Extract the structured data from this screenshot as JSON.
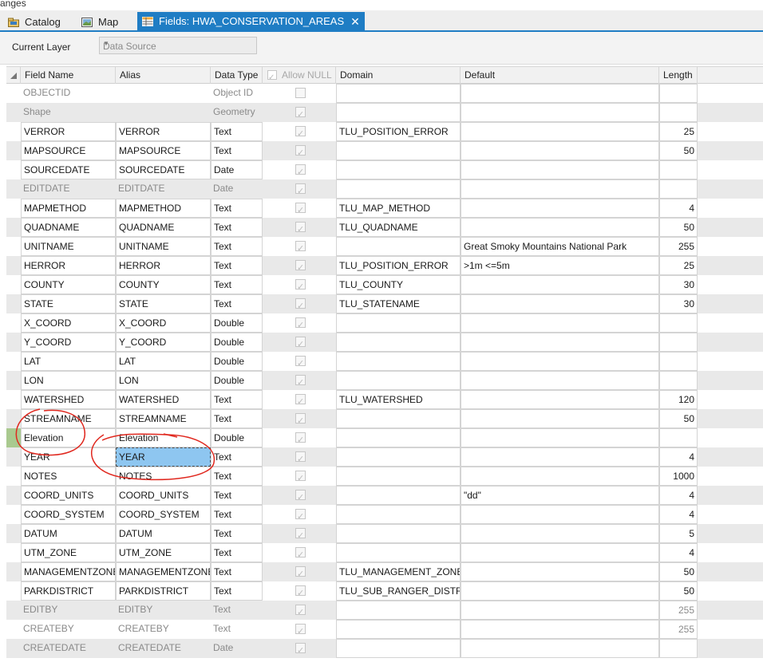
{
  "top_label": "anges",
  "tabs": [
    {
      "label": "Catalog",
      "icon": "catalog-icon"
    },
    {
      "label": "Map",
      "icon": "map-icon"
    },
    {
      "label": "Fields:  HWA_CONSERVATION_AREAS",
      "icon": "fields-table-icon"
    }
  ],
  "layer": {
    "label": "Current Layer",
    "value": "Data Source"
  },
  "columns": [
    "Field Name",
    "Alias",
    "Data Type",
    "Allow NULL",
    "Domain",
    "Default",
    "Length"
  ],
  "rows": [
    {
      "name": "OBJECTID",
      "alias": "",
      "type": "Object ID",
      "null": false,
      "domain": "",
      "default": "",
      "length": "",
      "ro": true
    },
    {
      "name": "Shape",
      "alias": "",
      "type": "Geometry",
      "null": true,
      "domain": "",
      "default": "",
      "length": "",
      "ro": true
    },
    {
      "name": "VERROR",
      "alias": "VERROR",
      "type": "Text",
      "null": true,
      "domain": "TLU_POSITION_ERROR",
      "default": "",
      "length": "25",
      "ro": false
    },
    {
      "name": "MAPSOURCE",
      "alias": "MAPSOURCE",
      "type": "Text",
      "null": true,
      "domain": "",
      "default": "",
      "length": "50",
      "ro": false
    },
    {
      "name": "SOURCEDATE",
      "alias": "SOURCEDATE",
      "type": "Date",
      "null": true,
      "domain": "",
      "default": "",
      "length": "",
      "ro": false
    },
    {
      "name": "EDITDATE",
      "alias": "EDITDATE",
      "type": "Date",
      "null": true,
      "domain": "",
      "default": "",
      "length": "",
      "ro": true
    },
    {
      "name": "MAPMETHOD",
      "alias": "MAPMETHOD",
      "type": "Text",
      "null": true,
      "domain": "TLU_MAP_METHOD",
      "default": "",
      "length": "4",
      "ro": false
    },
    {
      "name": "QUADNAME",
      "alias": "QUADNAME",
      "type": "Text",
      "null": true,
      "domain": "TLU_QUADNAME",
      "default": "",
      "length": "50",
      "ro": false
    },
    {
      "name": "UNITNAME",
      "alias": "UNITNAME",
      "type": "Text",
      "null": true,
      "domain": "",
      "default": "Great Smoky Mountains National Park",
      "length": "255",
      "ro": false
    },
    {
      "name": "HERROR",
      "alias": "HERROR",
      "type": "Text",
      "null": true,
      "domain": "TLU_POSITION_ERROR",
      "default": ">1m <=5m",
      "length": "25",
      "ro": false
    },
    {
      "name": "COUNTY",
      "alias": "COUNTY",
      "type": "Text",
      "null": true,
      "domain": "TLU_COUNTY",
      "default": "",
      "length": "30",
      "ro": false
    },
    {
      "name": "STATE",
      "alias": "STATE",
      "type": "Text",
      "null": true,
      "domain": "TLU_STATENAME",
      "default": "",
      "length": "30",
      "ro": false
    },
    {
      "name": "X_COORD",
      "alias": "X_COORD",
      "type": "Double",
      "null": true,
      "domain": "",
      "default": "",
      "length": "",
      "ro": false
    },
    {
      "name": "Y_COORD",
      "alias": "Y_COORD",
      "type": "Double",
      "null": true,
      "domain": "",
      "default": "",
      "length": "",
      "ro": false
    },
    {
      "name": "LAT",
      "alias": "LAT",
      "type": "Double",
      "null": true,
      "domain": "",
      "default": "",
      "length": "",
      "ro": false
    },
    {
      "name": "LON",
      "alias": "LON",
      "type": "Double",
      "null": true,
      "domain": "",
      "default": "",
      "length": "",
      "ro": false
    },
    {
      "name": "WATERSHED",
      "alias": "WATERSHED",
      "type": "Text",
      "null": true,
      "domain": "TLU_WATERSHED",
      "default": "",
      "length": "120",
      "ro": false
    },
    {
      "name": "STREAMNAME",
      "alias": "STREAMNAME",
      "type": "Text",
      "null": true,
      "domain": "",
      "default": "",
      "length": "50",
      "ro": false
    },
    {
      "name": "Elevation",
      "alias": "Elevation",
      "type": "Double",
      "null": true,
      "domain": "",
      "default": "",
      "length": "",
      "ro": false
    },
    {
      "name": "YEAR",
      "alias": "YEAR",
      "type": "Text",
      "null": true,
      "domain": "",
      "default": "",
      "length": "4",
      "ro": false
    },
    {
      "name": "NOTES",
      "alias": "NOTES",
      "type": "Text",
      "null": true,
      "domain": "",
      "default": "",
      "length": "1000",
      "ro": false
    },
    {
      "name": "COORD_UNITS",
      "alias": "COORD_UNITS",
      "type": "Text",
      "null": true,
      "domain": "",
      "default": "\"dd\"",
      "length": "4",
      "ro": false
    },
    {
      "name": "COORD_SYSTEM",
      "alias": "COORD_SYSTEM",
      "type": "Text",
      "null": true,
      "domain": "",
      "default": "",
      "length": "4",
      "ro": false
    },
    {
      "name": "DATUM",
      "alias": "DATUM",
      "type": "Text",
      "null": true,
      "domain": "",
      "default": "",
      "length": "5",
      "ro": false
    },
    {
      "name": "UTM_ZONE",
      "alias": "UTM_ZONE",
      "type": "Text",
      "null": true,
      "domain": "",
      "default": "",
      "length": "4",
      "ro": false
    },
    {
      "name": "MANAGEMENTZONE",
      "alias": "MANAGEMENTZONE",
      "type": "Text",
      "null": true,
      "domain": "TLU_MANAGEMENT_ZONE",
      "default": "",
      "length": "50",
      "ro": false
    },
    {
      "name": "PARKDISTRICT",
      "alias": "PARKDISTRICT",
      "type": "Text",
      "null": true,
      "domain": "TLU_SUB_RANGER_DISTRICT",
      "default": "",
      "length": "50",
      "ro": false
    },
    {
      "name": "EDITBY",
      "alias": "EDITBY",
      "type": "Text",
      "null": true,
      "domain": "",
      "default": "",
      "length": "255",
      "ro": true
    },
    {
      "name": "CREATEBY",
      "alias": "CREATEBY",
      "type": "Text",
      "null": true,
      "domain": "",
      "default": "",
      "length": "255",
      "ro": true
    },
    {
      "name": "CREATEDATE",
      "alias": "CREATEDATE",
      "type": "Date",
      "null": true,
      "domain": "",
      "default": "",
      "length": "",
      "ro": true
    }
  ],
  "selected_row": "YEAR",
  "highlighted_row": "Elevation",
  "annotation_color": "#e0281f",
  "selection_color": "#8ec6f0"
}
